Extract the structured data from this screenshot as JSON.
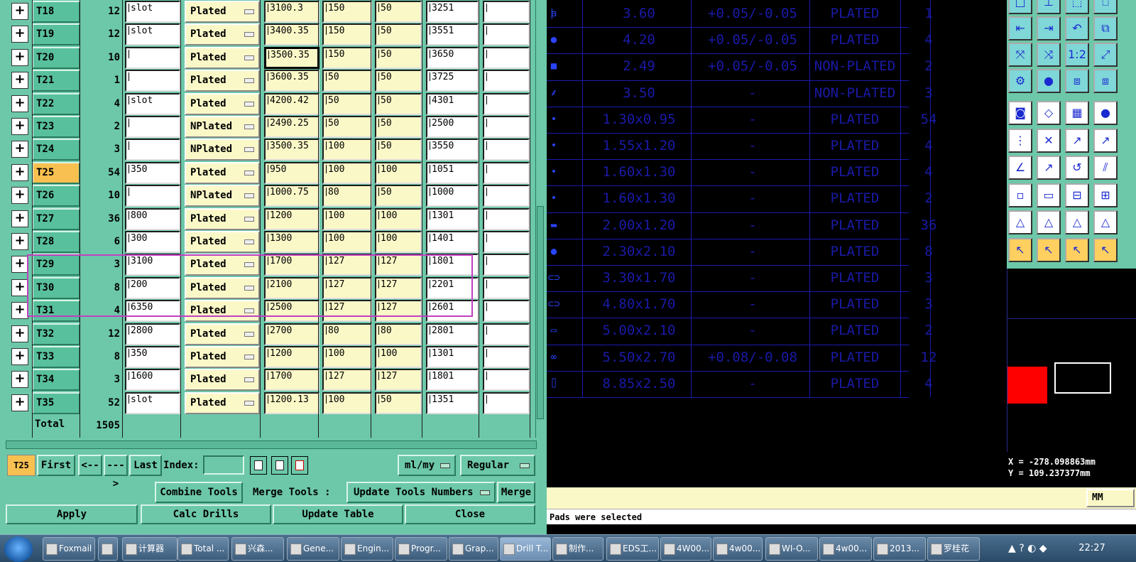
{
  "table": {
    "rows": [
      {
        "tool": "T18",
        "count": "12",
        "note": "slot",
        "type": "Plated",
        "size": "3100.3",
        "ptol": "150",
        "mtol": "50",
        "finish": "3251"
      },
      {
        "tool": "T19",
        "count": "12",
        "note": "slot",
        "type": "Plated",
        "size": "3400.35",
        "ptol": "150",
        "mtol": "50",
        "finish": "3551"
      },
      {
        "tool": "T20",
        "count": "10",
        "note": "",
        "type": "Plated",
        "size": "3500.35",
        "ptol": "150",
        "mtol": "50",
        "finish": "3650"
      },
      {
        "tool": "T21",
        "count": "1",
        "note": "",
        "type": "Plated",
        "size": "3600.35",
        "ptol": "50",
        "mtol": "50",
        "finish": "3725"
      },
      {
        "tool": "T22",
        "count": "4",
        "note": "slot",
        "type": "Plated",
        "size": "4200.42",
        "ptol": "50",
        "mtol": "50",
        "finish": "4301"
      },
      {
        "tool": "T23",
        "count": "2",
        "note": "",
        "type": "NPlated",
        "size": "2490.25",
        "ptol": "50",
        "mtol": "50",
        "finish": "2500"
      },
      {
        "tool": "T24",
        "count": "3",
        "note": "",
        "type": "NPlated",
        "size": "3500.35",
        "ptol": "100",
        "mtol": "50",
        "finish": "3550"
      },
      {
        "tool": "T25",
        "count": "54",
        "note": "350",
        "type": "Plated",
        "size": "950",
        "ptol": "100",
        "mtol": "100",
        "finish": "1051"
      },
      {
        "tool": "T26",
        "count": "10",
        "note": "",
        "type": "NPlated",
        "size": "1000.75",
        "ptol": "80",
        "mtol": "50",
        "finish": "1000"
      },
      {
        "tool": "T27",
        "count": "36",
        "note": "800",
        "type": "Plated",
        "size": "1200",
        "ptol": "100",
        "mtol": "100",
        "finish": "1301"
      },
      {
        "tool": "T28",
        "count": "6",
        "note": "300",
        "type": "Plated",
        "size": "1300",
        "ptol": "100",
        "mtol": "100",
        "finish": "1401"
      },
      {
        "tool": "T29",
        "count": "3",
        "note": "3100",
        "type": "Plated",
        "size": "1700",
        "ptol": "127",
        "mtol": "127",
        "finish": "1801"
      },
      {
        "tool": "T30",
        "count": "8",
        "note": "200",
        "type": "Plated",
        "size": "2100",
        "ptol": "127",
        "mtol": "127",
        "finish": "2201"
      },
      {
        "tool": "T31",
        "count": "4",
        "note": "6350",
        "type": "Plated",
        "size": "2500",
        "ptol": "127",
        "mtol": "127",
        "finish": "2601"
      },
      {
        "tool": "T32",
        "count": "12",
        "note": "2800",
        "type": "Plated",
        "size": "2700",
        "ptol": "80",
        "mtol": "80",
        "finish": "2801"
      },
      {
        "tool": "T33",
        "count": "8",
        "note": "350",
        "type": "Plated",
        "size": "1200",
        "ptol": "100",
        "mtol": "100",
        "finish": "1301"
      },
      {
        "tool": "T34",
        "count": "3",
        "note": "1600",
        "type": "Plated",
        "size": "1700",
        "ptol": "127",
        "mtol": "127",
        "finish": "1801"
      },
      {
        "tool": "T35",
        "count": "52",
        "note": "slot",
        "type": "Plated",
        "size": "1200.13",
        "ptol": "100",
        "mtol": "50",
        "finish": "1351"
      }
    ],
    "total_label": "Total",
    "total_value": "1505",
    "active_tool": "T25"
  },
  "nav": {
    "current": "T25",
    "first": "First",
    "prev": "<--",
    "next": "--->",
    "last": "Last",
    "index_label": "Index:",
    "units": "ml/my",
    "mode": "Regular"
  },
  "merge": {
    "combine": "Combine Tools",
    "merge_label": "Merge Tools :",
    "update_numbers": "Update Tools Numbers",
    "merge": "Merge"
  },
  "actions": {
    "apply": "Apply",
    "calc": "Calc Drills",
    "update": "Update Table",
    "close": "Close"
  },
  "pads": [
    {
      "size": "3.60",
      "tol": "+0.05/-0.05",
      "plating": "PLATED",
      "qty": "1"
    },
    {
      "size": "4.20",
      "tol": "+0.05/-0.05",
      "plating": "PLATED",
      "qty": "4"
    },
    {
      "size": "2.49",
      "tol": "+0.05/-0.05",
      "plating": "NON-PLATED",
      "qty": "2"
    },
    {
      "size": "3.50",
      "tol": "-",
      "plating": "NON-PLATED",
      "qty": "3"
    },
    {
      "size": "1.30x0.95",
      "tol": "-",
      "plating": "PLATED",
      "qty": "54"
    },
    {
      "size": "1.55x1.20",
      "tol": "-",
      "plating": "PLATED",
      "qty": "4"
    },
    {
      "size": "1.60x1.30",
      "tol": "-",
      "plating": "PLATED",
      "qty": "4"
    },
    {
      "size": "1.60x1.30",
      "tol": "-",
      "plating": "PLATED",
      "qty": "2"
    },
    {
      "size": "2.00x1.20",
      "tol": "-",
      "plating": "PLATED",
      "qty": "36"
    },
    {
      "size": "2.30x2.10",
      "tol": "-",
      "plating": "PLATED",
      "qty": "8"
    },
    {
      "size": "3.30x1.70",
      "tol": "-",
      "plating": "PLATED",
      "qty": "3"
    },
    {
      "size": "4.80x1.70",
      "tol": "-",
      "plating": "PLATED",
      "qty": "3"
    },
    {
      "size": "5.00x2.10",
      "tol": "-",
      "plating": "PLATED",
      "qty": "2"
    },
    {
      "size": "5.50x2.70",
      "tol": "+0.08/-0.08",
      "plating": "PLATED",
      "qty": "12"
    },
    {
      "size": "8.85x2.50",
      "tol": "-",
      "plating": "PLATED",
      "qty": "4"
    }
  ],
  "coords": {
    "x": "X = -278.098863mm",
    "y": "Y = 109.237377mm"
  },
  "status": {
    "units": "MM",
    "message": "Pads were selected"
  },
  "taskbar": {
    "items": [
      "Foxmail",
      "",
      "计算器",
      "Total ...",
      "兴森...",
      "Gene...",
      "Engin...",
      "Progr...",
      "Grap...",
      "Drill T...",
      "制作...",
      "EDS工...",
      "4W00...",
      "4w00...",
      "WI-O...",
      "4w00...",
      "2013...",
      "罗桂花"
    ],
    "clock": "22:27"
  },
  "colors": {
    "panel": "#6cc8a8",
    "active_tool": "#f8c050",
    "highlight": "#c040c0",
    "pad_text": "#1a1aa8",
    "grid": "#1a1ab0"
  }
}
